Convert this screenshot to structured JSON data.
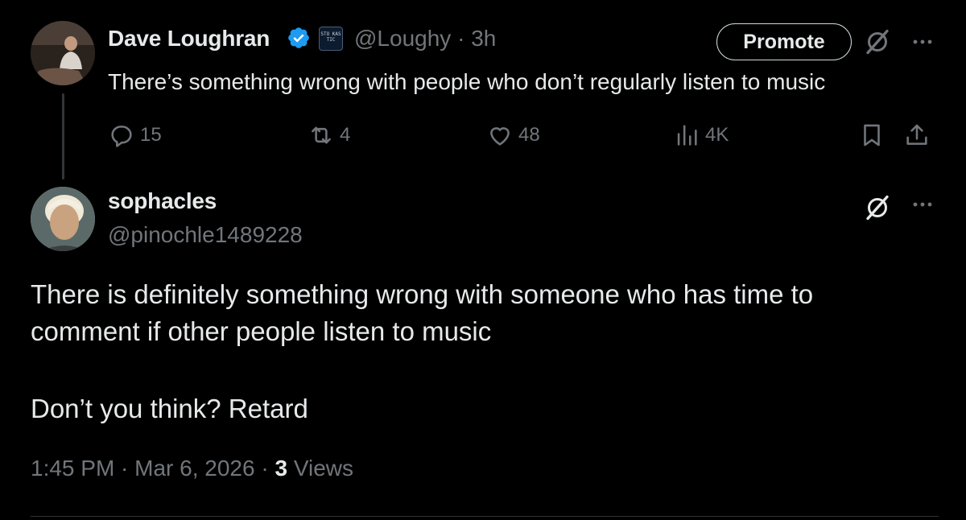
{
  "original_tweet": {
    "author_name": "Dave Loughran",
    "affiliate_badge_text": "STO KAS TIC",
    "handle": "@Loughy",
    "separator": "·",
    "time": "3h",
    "promote_label": "Promote",
    "text": "There’s something wrong with people who don’t regularly listen to music",
    "stats": {
      "replies": "15",
      "reposts": "4",
      "likes": "48",
      "views": "4K"
    }
  },
  "reply": {
    "author_name": "sophacles",
    "handle": "@pinochle1489228",
    "line1": "There is definitely something wrong with someone who has time to",
    "line2": "comment if other people listen to music",
    "line3": "Don’t you think? Retard",
    "timestamp": "1:45 PM · Mar 6, 2026 · ",
    "views_count": "3",
    "views_label": " Views"
  },
  "icons": {
    "verified": "verified-badge-icon",
    "grok": "grok-icon",
    "more": "more-icon",
    "reply": "reply-icon",
    "repost": "repost-icon",
    "like": "like-icon",
    "views": "views-icon",
    "bookmark": "bookmark-icon",
    "share": "share-icon"
  },
  "colors": {
    "background": "#000000",
    "text_primary": "#e7e9ea",
    "text_secondary": "#71767b",
    "verified_blue": "#1d9bf0"
  }
}
